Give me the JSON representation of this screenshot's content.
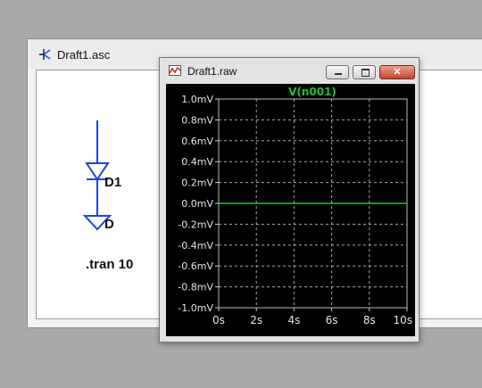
{
  "schematic_window": {
    "title": "Draft1.asc",
    "component_label": "D1",
    "component_value": "D",
    "directive": ".tran 10"
  },
  "waveform_window": {
    "title": "Draft1.raw",
    "controls": {
      "minimize": "minimize",
      "maximize": "maximize",
      "close": "close"
    },
    "trace_color": "#22c23a",
    "grid_color": "#a8a8a8"
  },
  "chart_data": {
    "type": "line",
    "title": "V(n001)",
    "xlabel": "",
    "ylabel": "",
    "x_ticks": [
      "0s",
      "2s",
      "4s",
      "6s",
      "8s",
      "10s"
    ],
    "y_ticks": [
      "1.0mV",
      "0.8mV",
      "0.6mV",
      "0.4mV",
      "0.2mV",
      "0.0mV",
      "-0.2mV",
      "-0.4mV",
      "-0.6mV",
      "-0.8mV",
      "-1.0mV"
    ],
    "xlim": [
      0,
      10
    ],
    "ylim": [
      -1.0,
      1.0
    ],
    "grid": true,
    "series": [
      {
        "name": "V(n001)",
        "x": [
          0,
          10
        ],
        "y": [
          0.0,
          0.0
        ]
      }
    ]
  }
}
